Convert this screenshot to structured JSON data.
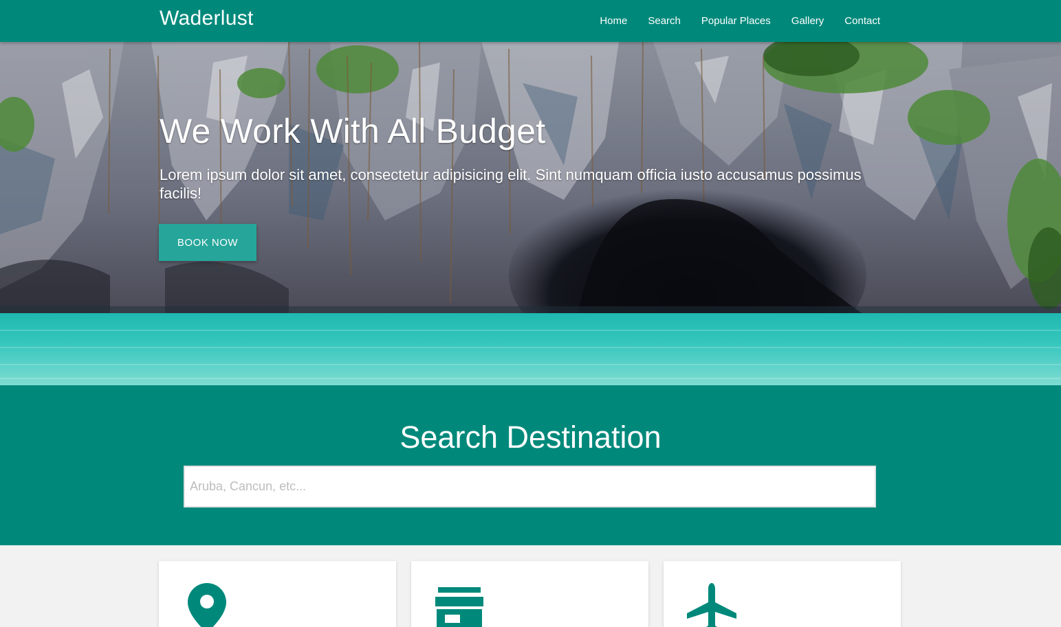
{
  "navbar": {
    "brand": "Waderlust",
    "links": [
      "Home",
      "Search",
      "Popular Places",
      "Gallery",
      "Contact"
    ]
  },
  "hero": {
    "title": "We Work With All Budget",
    "text": "Lorem ipsum dolor sit amet, consectetur adipisicing elit. Sint numquam officia iusto accusamus possimus facilis!",
    "button_label": "BOOK NOW",
    "image": "cave-lagoon-photo"
  },
  "search": {
    "title": "Search Destination",
    "placeholder": "Aruba, Cancun, etc...",
    "value": ""
  },
  "cards": [
    {
      "icon": "map-marker-icon"
    },
    {
      "icon": "store-icon"
    },
    {
      "icon": "airplane-icon"
    }
  ],
  "colors": {
    "primary": "#00897b",
    "accent": "#26a69a",
    "background": "#f2f2f2"
  }
}
